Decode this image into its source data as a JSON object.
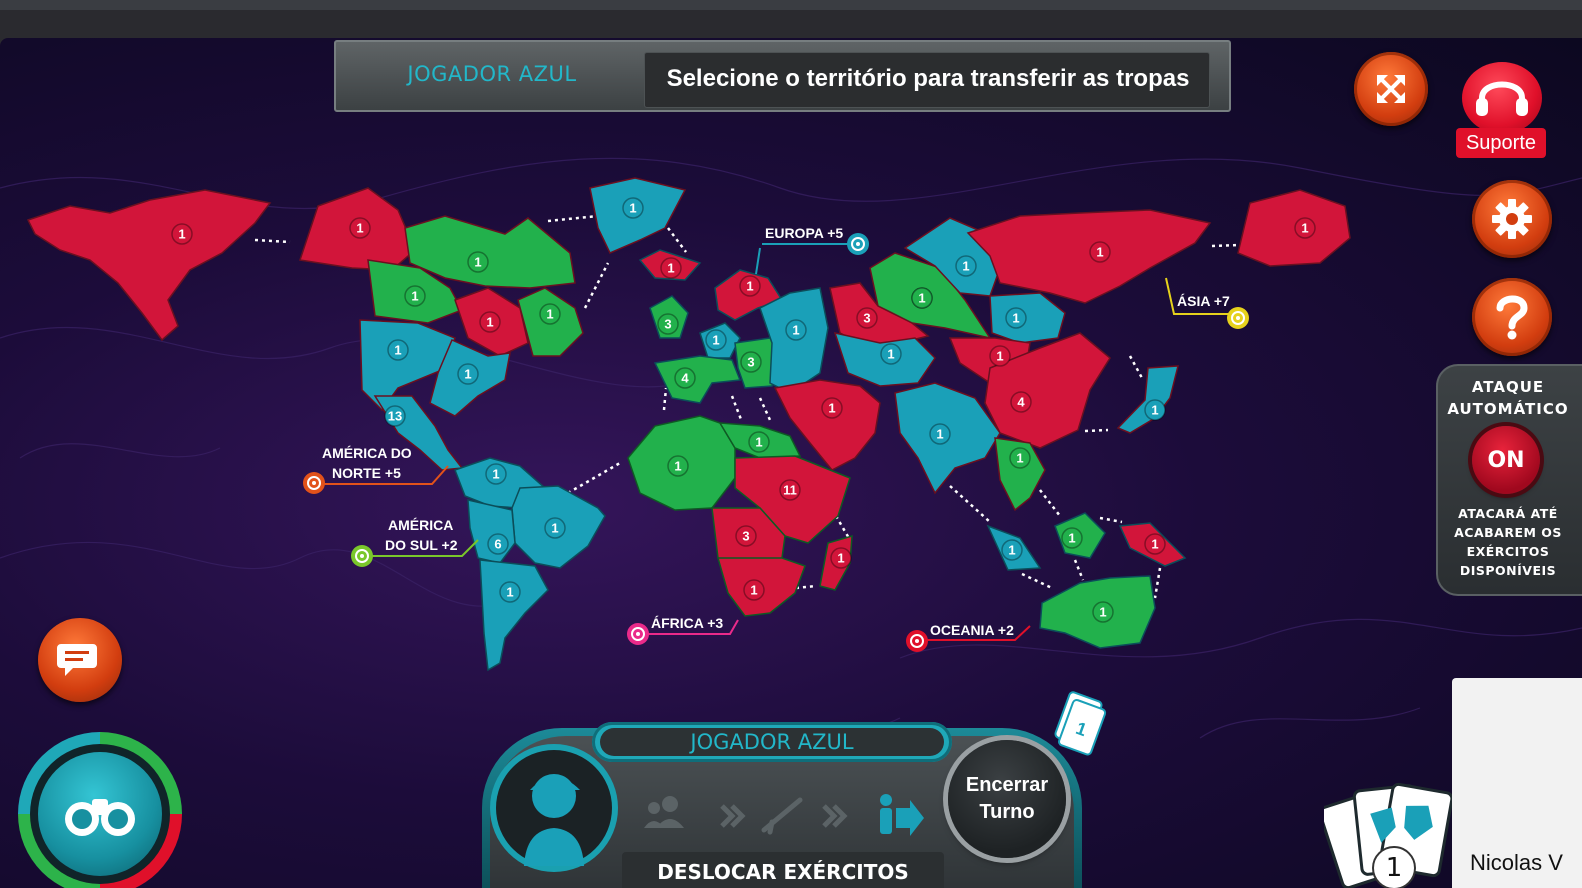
{
  "header": {
    "player": "JOGADOR AZUL",
    "message": "Selecione o território para transferir as tropas"
  },
  "buttons": {
    "support_label": "Suporte"
  },
  "auto_attack": {
    "title_line1": "ATAQUE",
    "title_line2": "AUTOMÁTICO",
    "toggle": "ON",
    "desc_line1": "ATACARÁ ATÉ",
    "desc_line2": "ACABAREM OS",
    "desc_line3": "EXÉRCITOS",
    "desc_line4": "DISPONÍVEIS"
  },
  "continents": {
    "north_america_1": "AMÉRICA DO",
    "north_america_2": "NORTE +5",
    "south_america_1": "AMÉRICA",
    "south_america_2": "DO SUL +2",
    "europe": "EUROPA +5",
    "asia": "ÁSIA +7",
    "africa": "ÁFRICA +3",
    "oceania": "OCEANIA +2"
  },
  "colors": {
    "red": "#d2153a",
    "blue": "#1aa0b8",
    "green": "#22b14c",
    "accent_orange": "#e2521a"
  },
  "territories": [
    {
      "owner": "red",
      "armies": "1"
    },
    {
      "owner": "red",
      "armies": "1"
    },
    {
      "owner": "green",
      "armies": "1"
    },
    {
      "owner": "blue",
      "armies": "1"
    },
    {
      "owner": "green",
      "armies": "1"
    },
    {
      "owner": "red",
      "armies": "1"
    },
    {
      "owner": "green",
      "armies": "1"
    },
    {
      "owner": "blue",
      "armies": "1"
    },
    {
      "owner": "blue",
      "armies": "1"
    },
    {
      "owner": "blue",
      "armies": "13"
    },
    {
      "owner": "red",
      "armies": "1"
    },
    {
      "owner": "green",
      "armies": "3"
    },
    {
      "owner": "blue",
      "armies": "1"
    },
    {
      "owner": "red",
      "armies": "1"
    },
    {
      "owner": "blue",
      "armies": "1"
    },
    {
      "owner": "green",
      "armies": "3"
    },
    {
      "owner": "green",
      "armies": "4"
    },
    {
      "owner": "blue",
      "armies": "1"
    },
    {
      "owner": "blue",
      "armies": "1"
    },
    {
      "owner": "green",
      "armies": "1"
    },
    {
      "owner": "red",
      "armies": "3"
    },
    {
      "owner": "blue",
      "armies": "1"
    },
    {
      "owner": "red",
      "armies": "1"
    },
    {
      "owner": "red",
      "armies": "1"
    },
    {
      "owner": "red",
      "armies": "1"
    },
    {
      "owner": "blue",
      "armies": "1"
    },
    {
      "owner": "red",
      "armies": "4"
    },
    {
      "owner": "blue",
      "armies": "1"
    },
    {
      "owner": "green",
      "armies": "1"
    },
    {
      "owner": "blue",
      "armies": "1"
    },
    {
      "owner": "red",
      "armies": "1"
    },
    {
      "owner": "blue",
      "armies": "1"
    },
    {
      "owner": "green",
      "armies": "1"
    },
    {
      "owner": "red",
      "armies": "1"
    },
    {
      "owner": "green",
      "armies": "1"
    },
    {
      "owner": "blue",
      "armies": "1"
    },
    {
      "owner": "blue",
      "armies": "6"
    },
    {
      "owner": "blue",
      "armies": "1"
    },
    {
      "owner": "blue",
      "armies": "1"
    },
    {
      "owner": "green",
      "armies": "1"
    },
    {
      "owner": "green",
      "armies": "1"
    },
    {
      "owner": "red",
      "armies": "11"
    },
    {
      "owner": "red",
      "armies": "3"
    },
    {
      "owner": "red",
      "armies": "1"
    },
    {
      "owner": "red",
      "armies": "1"
    }
  ],
  "bottom_panel": {
    "player": "JOGADOR AZUL",
    "end_turn_1": "Encerrar",
    "end_turn_2": "Turno",
    "phase": "DESLOCAR EXÉRCITOS",
    "cards_top": "1"
  },
  "cards_count": "1",
  "user_name": "Nicolas V"
}
